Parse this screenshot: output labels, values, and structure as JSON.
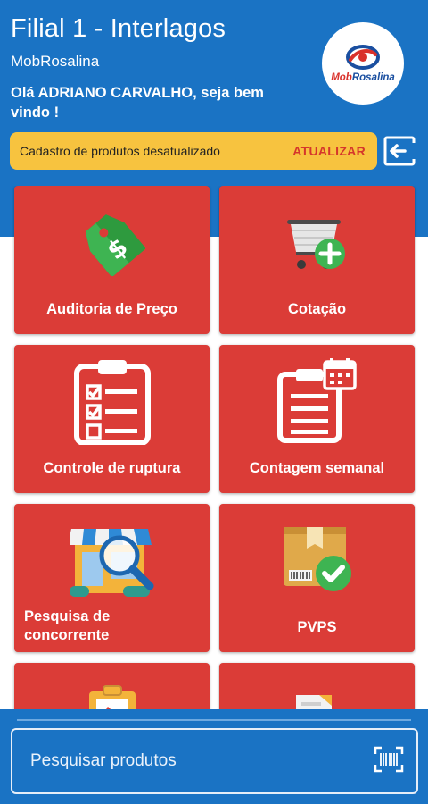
{
  "header": {
    "store_name": "Filial 1 - Interlagos",
    "company": "MobRosalina",
    "greeting": "Olá ADRIANO CARVALHO, seja bem vindo !",
    "logo_text_part1": "Mob",
    "logo_text_part2": "Rosalina",
    "background": "#1a73c4"
  },
  "alert": {
    "message": "Cadastro de produtos desatualizado",
    "action": "ATUALIZAR",
    "background": "#f7c33f",
    "action_color": "#d5362b"
  },
  "exit_button": {
    "icon": "logout-icon"
  },
  "tiles": [
    {
      "label": "Auditoria de Preço",
      "icon": "price-tag-dollar-icon"
    },
    {
      "label": "Cotação",
      "icon": "cart-add-icon"
    },
    {
      "label": "Controle de ruptura",
      "icon": "clipboard-checklist-icon"
    },
    {
      "label": "Contagem semanal",
      "icon": "clipboard-calendar-icon"
    },
    {
      "label": "Pesquisa de concorrente",
      "icon": "store-magnifier-icon"
    },
    {
      "label": "PVPS",
      "icon": "box-check-icon"
    }
  ],
  "tile_color": "#db3c37",
  "search": {
    "placeholder": "Pesquisar produtos",
    "scan_icon": "barcode-scan-icon"
  }
}
